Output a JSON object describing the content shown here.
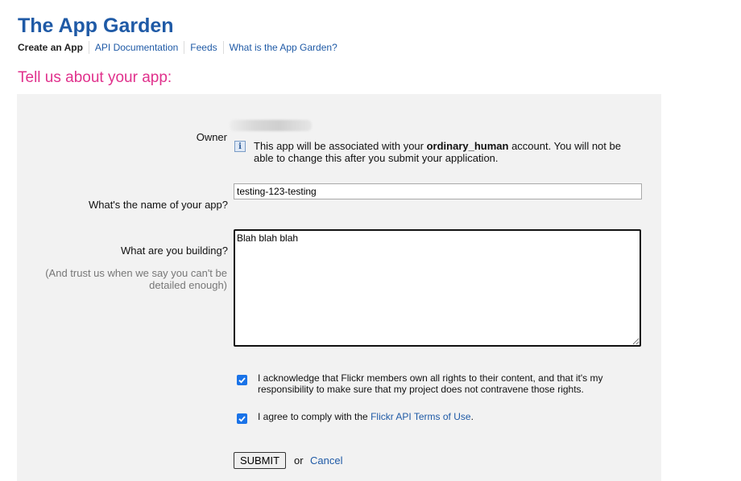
{
  "header": {
    "title": "The App Garden",
    "nav": [
      {
        "label": "Create an App",
        "active": true
      },
      {
        "label": "API Documentation"
      },
      {
        "label": "Feeds"
      },
      {
        "label": "What is the App Garden?"
      }
    ]
  },
  "section_heading": "Tell us about your app:",
  "form": {
    "owner_label": "Owner",
    "owner_note_prefix": "This app will be associated with your ",
    "owner_username": "ordinary_human",
    "owner_note_suffix": " account. You will not be able to change this after you submit your application.",
    "info_icon": "info-icon",
    "app_name_label": "What's the name of your app?",
    "app_name_value": "testing-123-testing",
    "building_label": "What are you building?",
    "building_hint": "(And trust us when we say you can't be detailed enough)",
    "building_value": "Blah blah blah",
    "ack_checked": true,
    "ack_text": "I acknowledge that Flickr members own all rights to their content, and that it's my responsibility to make sure that my project does not contravene those rights.",
    "terms_checked": true,
    "terms_prefix": "I agree to comply with the ",
    "terms_link": "Flickr API Terms of Use",
    "terms_suffix": ".",
    "submit_label": "SUBMIT",
    "or_text": "or",
    "cancel_label": "Cancel"
  },
  "colors": {
    "title": "#1f5aa6",
    "heading": "#e0318c",
    "link": "#1f5aa6",
    "panel": "#f2f2f2",
    "checkbox": "#1a73e8"
  }
}
